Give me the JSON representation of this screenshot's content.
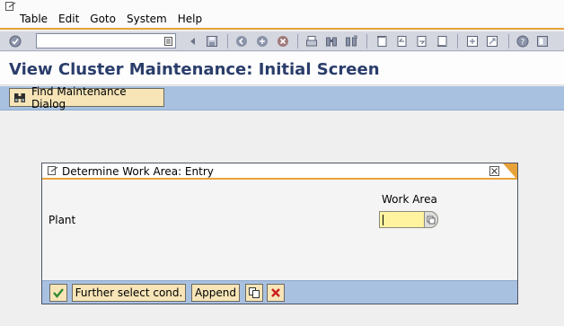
{
  "menu": {
    "items": [
      {
        "label": "Table"
      },
      {
        "label": "Edit"
      },
      {
        "label": "Goto"
      },
      {
        "label": "System"
      },
      {
        "label": "Help"
      }
    ]
  },
  "toolbar": {
    "command_field_value": ""
  },
  "title": "View Cluster Maintenance: Initial Screen",
  "app_toolbar": {
    "find_button_label": "Find Maintenance Dialog"
  },
  "dialog": {
    "title": "Determine Work Area: Entry",
    "column_header": "Work Area",
    "field_label": "Plant",
    "field_value": "",
    "buttons": {
      "further_select": "Further select cond.",
      "append": "Append"
    }
  },
  "colors": {
    "accent_orange": "#e8a23a",
    "title_blue": "#2a3d6b",
    "toolbar_blue": "#a8c1e1",
    "button_beige": "#f7e5b8",
    "input_yellow": "#fff3a0"
  }
}
